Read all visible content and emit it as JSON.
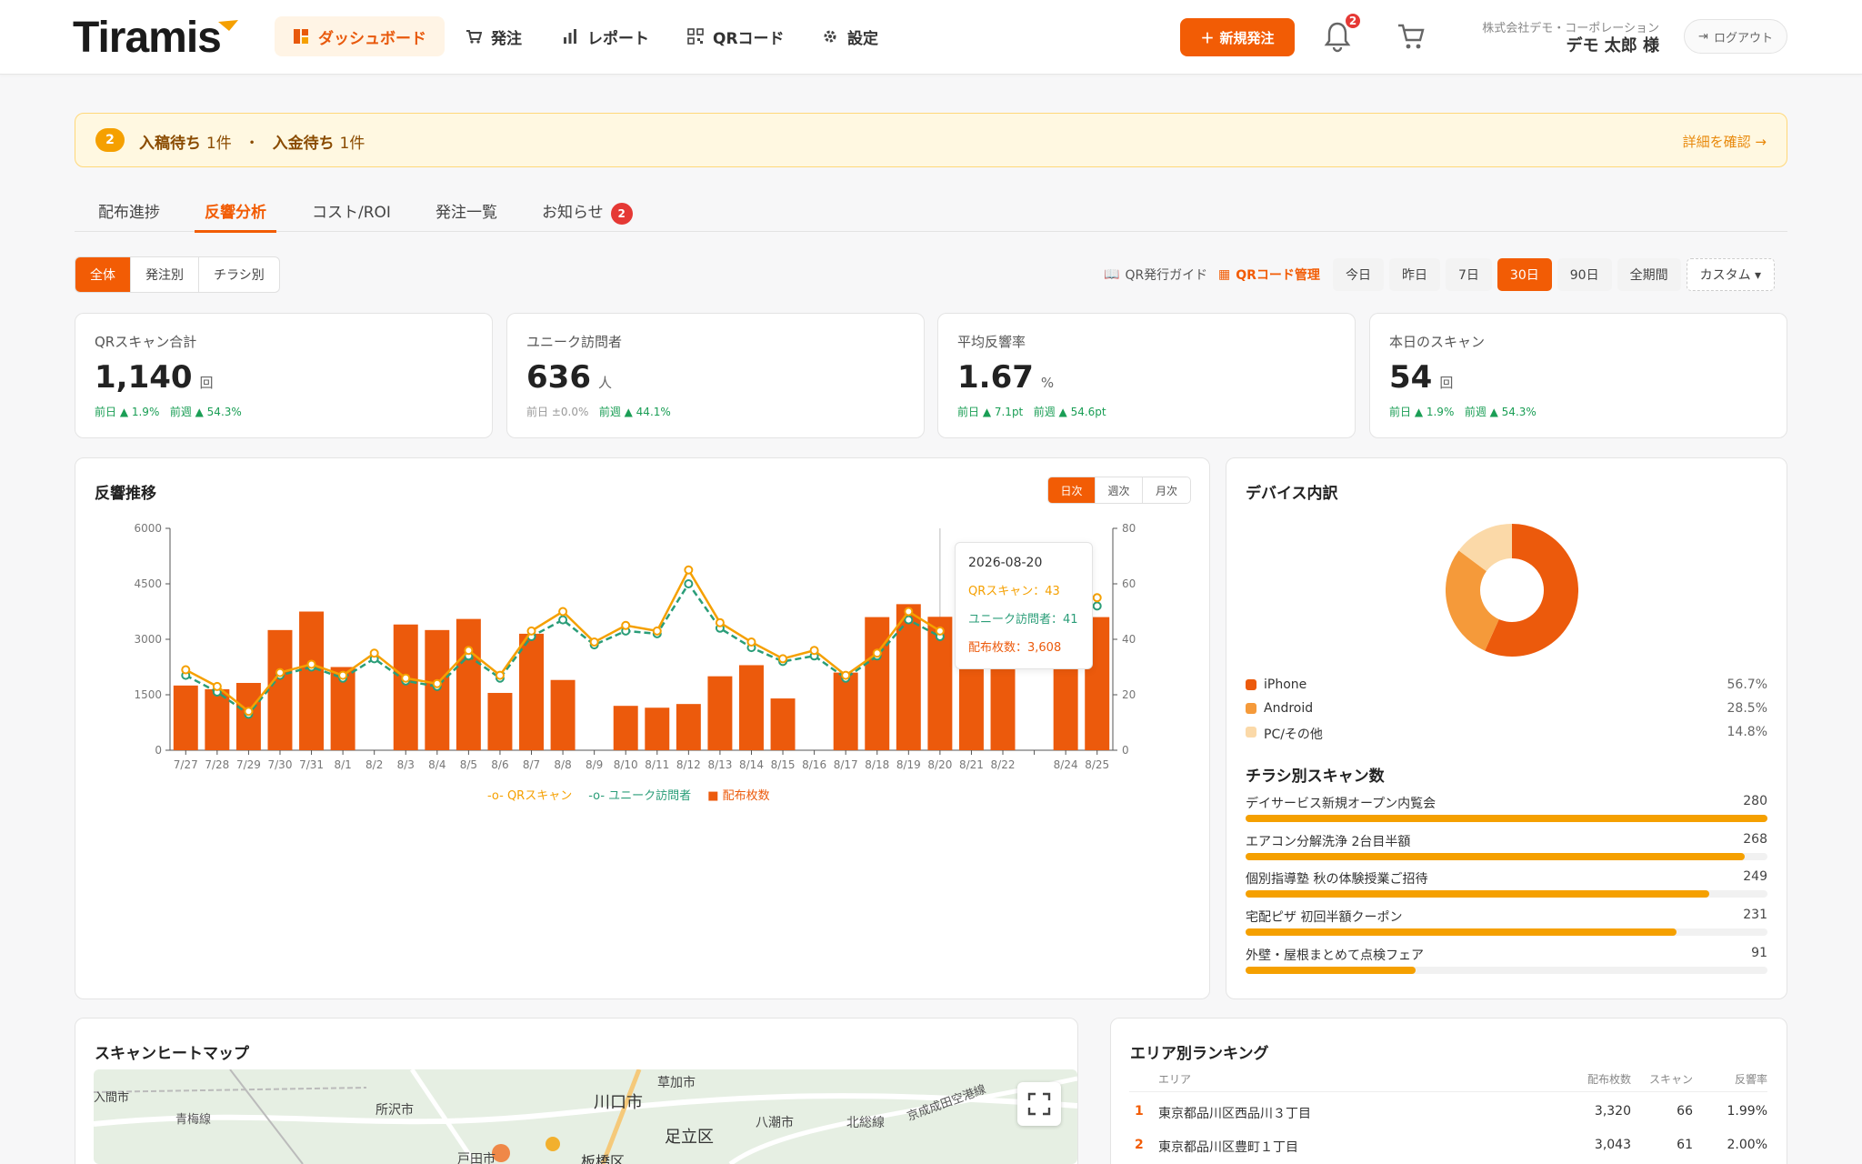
{
  "header": {
    "logo": "Tiramis",
    "nav": [
      "ダッシュボード",
      "発注",
      "レポート",
      "QRコード",
      "設定"
    ],
    "new_order": "新規発注",
    "bell_badge": "2",
    "company": "株式会社デモ・コーポレーション",
    "user": "デモ 太郎 様",
    "logout": "ログアウト"
  },
  "alert": {
    "badge": "2",
    "item1": "入稿待ち",
    "count1": "1件",
    "sep": "・",
    "item2": "入金待ち",
    "count2": "1件",
    "link": "詳細を確認 →"
  },
  "tabs": [
    "配布進捗",
    "反響分析",
    "コスト/ROI",
    "発注一覧",
    "お知らせ"
  ],
  "tabs_badge": "2",
  "filter": [
    "全体",
    "発注別",
    "チラシ別"
  ],
  "qr_guide": "QR発行ガイド",
  "qr_manage": "QRコード管理",
  "range": [
    "今日",
    "昨日",
    "7日",
    "30日",
    "90日",
    "全期間",
    "カスタム ▾"
  ],
  "kpis": [
    {
      "label": "QRスキャン合計",
      "value": "1,140",
      "unit": "回",
      "d1": "前日 ▲ 1.9%",
      "d2": "前週 ▲ 54.3%"
    },
    {
      "label": "ユニーク訪問者",
      "value": "636",
      "unit": "人",
      "d1": "前日 ±0.0%",
      "d2": "前週 ▲ 44.1%"
    },
    {
      "label": "平均反響率",
      "value": "1.67",
      "unit": "%",
      "d1": "前日 ▲ 7.1pt",
      "d2": "前週 ▲ 54.6pt"
    },
    {
      "label": "本日のスキャン",
      "value": "54",
      "unit": "回",
      "d1": "前日 ▲ 1.9%",
      "d2": "前週 ▲ 54.3%"
    }
  ],
  "trend": {
    "title": "反響推移",
    "gran": [
      "日次",
      "週次",
      "月次"
    ],
    "tooltip": {
      "date": "2026-08-20",
      "qr": "QRスキャン：43",
      "uv": "ユニーク訪問者：41",
      "dist": "配布枚数：3,608"
    },
    "legend": [
      "QRスキャン",
      "ユニーク訪問者",
      "配布枚数"
    ]
  },
  "chart_data": {
    "type": "bar",
    "categories": [
      "7/27",
      "7/28",
      "7/29",
      "7/30",
      "7/31",
      "8/1",
      "8/2",
      "8/3",
      "8/4",
      "8/5",
      "8/6",
      "8/7",
      "8/8",
      "8/9",
      "8/10",
      "8/11",
      "8/12",
      "8/13",
      "8/14",
      "8/15",
      "8/16",
      "8/17",
      "8/18",
      "8/19",
      "8/20",
      "8/21",
      "8/22",
      "8/23",
      "8/24",
      "8/25"
    ],
    "tick_labels": [
      "7/27",
      "7/28",
      "7/29",
      "7/30",
      "7/31",
      "8/1",
      "8/2",
      "8/3",
      "8/4",
      "8/5",
      "8/6",
      "8/7",
      "8/8",
      "8/9",
      "8/10",
      "8/11",
      "8/12",
      "8/13",
      "8/14",
      "8/15",
      "8/16",
      "8/17",
      "8/18",
      "8/19",
      "8/20",
      "8/21",
      "8/22",
      "",
      "8/24",
      "8/25"
    ],
    "series": [
      {
        "name": "配布枚数",
        "axis": "left",
        "kind": "bar",
        "color": "#ec5a0c",
        "values": [
          1750,
          1650,
          1820,
          3250,
          3750,
          2250,
          0,
          3400,
          3250,
          3550,
          1550,
          3150,
          1900,
          0,
          1200,
          1150,
          1250,
          2000,
          2300,
          1400,
          0,
          2100,
          3600,
          3950,
          3608,
          3100,
          3200,
          0,
          3500,
          3600
        ]
      },
      {
        "name": "QRスキャン",
        "axis": "right",
        "kind": "line",
        "color": "#f5a000",
        "values": [
          29,
          23,
          14,
          28,
          31,
          27,
          35,
          26,
          24,
          36,
          27,
          43,
          50,
          39,
          45,
          43,
          65,
          46,
          39,
          33,
          36,
          27,
          35,
          50,
          43,
          0,
          0,
          0,
          0,
          55
        ]
      },
      {
        "name": "ユニーク訪問者",
        "axis": "right",
        "kind": "dashed",
        "color": "#2a9d78",
        "values": [
          27,
          21,
          13,
          27,
          30,
          26,
          33,
          25,
          23,
          34,
          26,
          41,
          47,
          38,
          43,
          42,
          60,
          44,
          37,
          32,
          34,
          26,
          34,
          47,
          41,
          0,
          0,
          0,
          0,
          52
        ]
      }
    ],
    "y_left": {
      "min": 0,
      "max": 6000,
      "ticks": [
        0,
        1500,
        3000,
        4500,
        6000
      ]
    },
    "y_right": {
      "min": 0,
      "max": 80,
      "ticks": [
        0,
        20,
        40,
        60,
        80
      ]
    }
  },
  "device": {
    "title": "デバイス内訳",
    "items": [
      {
        "name": "iPhone",
        "pct": "56.7%",
        "value": 56.7,
        "color": "#ec5a0c"
      },
      {
        "name": "Android",
        "pct": "28.5%",
        "value": 28.5,
        "color": "#f59a3a"
      },
      {
        "name": "PC/その他",
        "pct": "14.8%",
        "value": 14.8,
        "color": "#fbd9a8"
      }
    ]
  },
  "flyers": {
    "title": "チラシ別スキャン数",
    "items": [
      {
        "name": "デイサービス新規オープン内覧会",
        "value": "280",
        "n": 280
      },
      {
        "name": "エアコン分解洗浄 2台目半額",
        "value": "268",
        "n": 268
      },
      {
        "name": "個別指導塾 秋の体験授業ご招待",
        "value": "249",
        "n": 249
      },
      {
        "name": "宅配ピザ 初回半額クーポン",
        "value": "231",
        "n": 231
      },
      {
        "name": "外壁・屋根まとめて点検フェア",
        "value": "91",
        "n": 91
      }
    ]
  },
  "heatmap": {
    "title": "スキャンヒートマップ",
    "labels": [
      "入間市",
      "所沢市",
      "川口市",
      "草加市",
      "足立区",
      "八潮市",
      "戸田市",
      "板橋区",
      "青梅線",
      "北総線",
      "京成成田空港線"
    ]
  },
  "ranking": {
    "title": "エリア別ランキング",
    "headers": [
      "エリア",
      "配布枚数",
      "スキャン",
      "反響率"
    ],
    "rows": [
      {
        "rank": "1",
        "area": "東京都品川区西品川３丁目",
        "dist": "3,320",
        "scan": "66",
        "rate": "1.99%"
      },
      {
        "rank": "2",
        "area": "東京都品川区豊町１丁目",
        "dist": "3,043",
        "scan": "61",
        "rate": "2.00%"
      }
    ]
  },
  "colors": {
    "accent": "#f25c05",
    "orange": "#f5a000",
    "green": "#2a9d78",
    "up": "#1a9e55"
  }
}
